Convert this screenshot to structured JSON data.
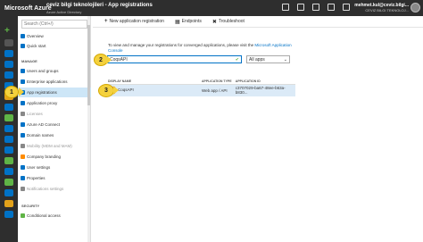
{
  "colors": {
    "bar": "#2e2e2e",
    "accent": "#0072c6",
    "selected": "#cde6f7",
    "callout": "#f4d13d",
    "app_icon": "#e377c2"
  },
  "topbar": {
    "brand": "Microsoft Azure",
    "user_name": "mehmet.kul@ceviz.bilgi...",
    "org": "CEVIZ BILGI TEKNOLOJ..."
  },
  "blade": {
    "title": "ceviz bilgi teknolojileri - App registrations",
    "subtitle": "Azure Active Directory"
  },
  "leftnav": {
    "search_placeholder": "Search (Ctrl+/)",
    "items_top": [
      {
        "label": "Overview",
        "color": "#0072c6"
      },
      {
        "label": "Quick start",
        "color": "#0072c6"
      }
    ],
    "section_manage": "MANAGE",
    "items_manage": [
      {
        "label": "Users and groups",
        "color": "#0072c6"
      },
      {
        "label": "Enterprise applications",
        "color": "#0072c6"
      },
      {
        "label": "App registrations",
        "color": "#0072c6"
      },
      {
        "label": "Application proxy",
        "color": "#0072c6"
      },
      {
        "label": "Licenses",
        "color": "#888888"
      },
      {
        "label": "Azure AD Connect",
        "color": "#0072c6"
      },
      {
        "label": "Domain names",
        "color": "#0072c6"
      },
      {
        "label": "Mobility (MDM and MAM)",
        "color": "#888888"
      },
      {
        "label": "Company branding",
        "color": "#ff8c00"
      },
      {
        "label": "User settings",
        "color": "#0072c6"
      },
      {
        "label": "Properties",
        "color": "#0072c6"
      },
      {
        "label": "Notifications settings",
        "color": "#888888"
      }
    ],
    "section_security": "SECURITY",
    "items_security": [
      {
        "label": "Conditional access",
        "color": "#5fb446"
      }
    ]
  },
  "toolbar": {
    "new_registration": "New application registration",
    "endpoints": "Endpoints",
    "troubleshoot": "Troubleshoot"
  },
  "main": {
    "info_text": "To view and manage your registrations for converged applications, please visit the",
    "info_link": "Microsoft Application Console",
    "search_value": "CoqsAPI",
    "filter_value": "All apps"
  },
  "table": {
    "headers": [
      "DISPLAY NAME",
      "APPLICATION TYPE",
      "APPLICATION ID"
    ],
    "rows": [
      {
        "name": "CoqsAPI",
        "type": "Web app / API",
        "id": "c3707029-ba67-48ee-b63a-b830..."
      }
    ]
  },
  "callouts": [
    "1",
    "2",
    "3"
  ]
}
